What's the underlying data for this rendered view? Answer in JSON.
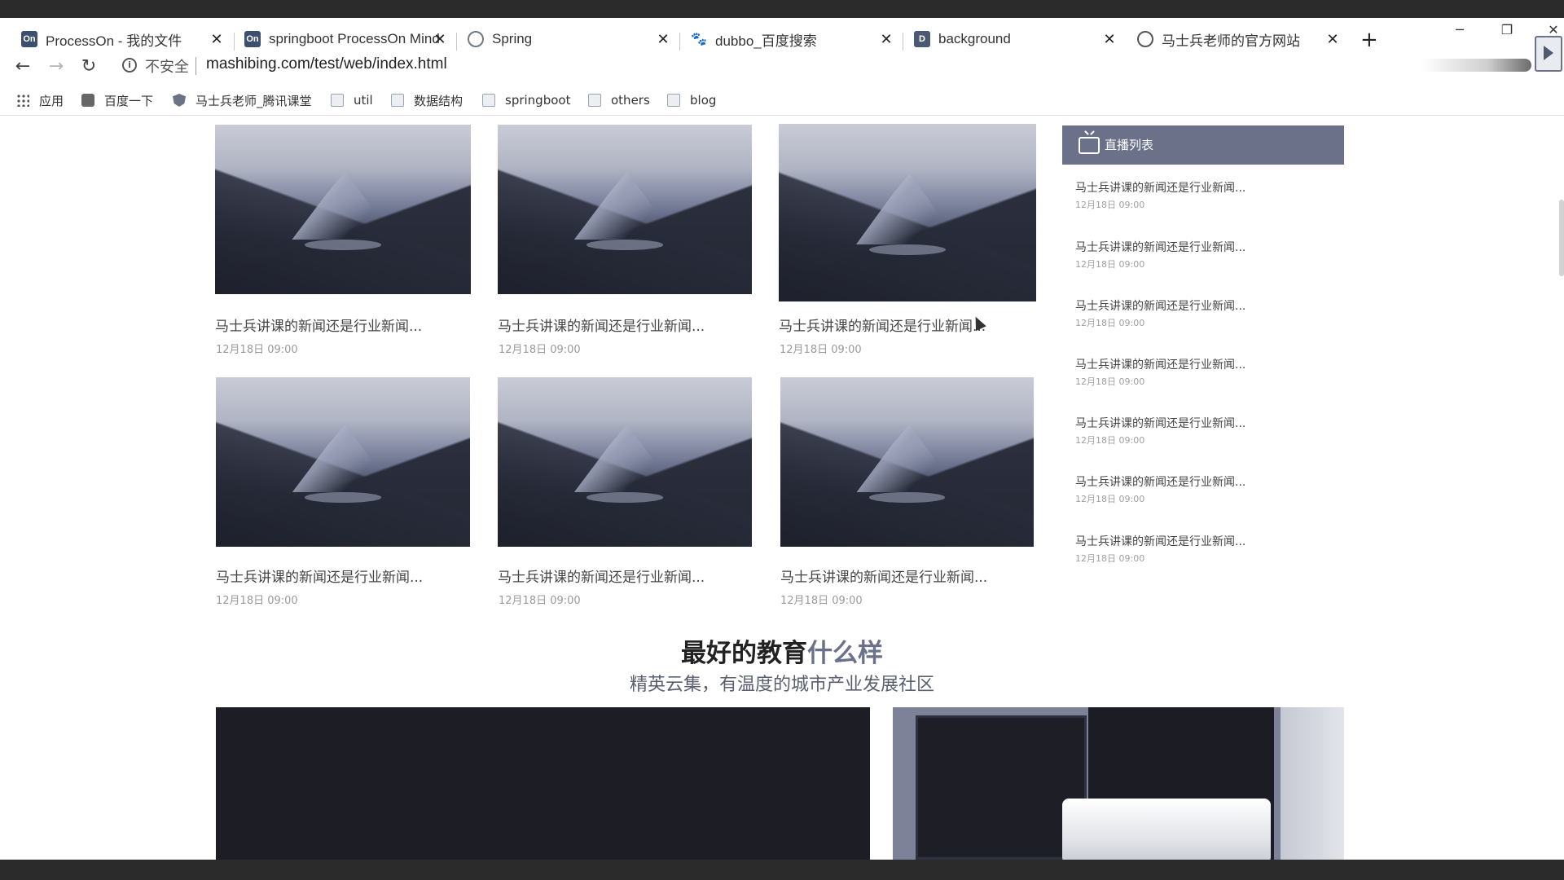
{
  "browser": {
    "tabs": [
      {
        "title": "ProcessOn - 我的文件",
        "favicon": "processon-icon"
      },
      {
        "title": "springboot ProcessOn Mind",
        "favicon": "processon-icon"
      },
      {
        "title": "Spring",
        "favicon": "spring-icon"
      },
      {
        "title": "dubbo_百度搜索",
        "favicon": "baidu-paw-icon"
      },
      {
        "title": "background",
        "favicon": "document-icon"
      },
      {
        "title": "马士兵老师的官方网站",
        "favicon": "globe-icon"
      }
    ],
    "new_tab": "+",
    "controls": {
      "minimize": "─",
      "restore": "❐",
      "close": "✕"
    },
    "address": {
      "security_label": "不安全",
      "url": "mashibing.com/test/web/index.html"
    },
    "bookmarks": [
      {
        "label": "应用",
        "icon": "apps-grid-icon"
      },
      {
        "label": "百度一下",
        "icon": "baidu-paw-icon"
      },
      {
        "label": "马士兵老师_腾讯课堂",
        "icon": "shield-icon"
      },
      {
        "label": "util",
        "icon": "folder-icon"
      },
      {
        "label": "数据结构",
        "icon": "folder-icon"
      },
      {
        "label": "springboot",
        "icon": "folder-icon"
      },
      {
        "label": "others",
        "icon": "folder-icon"
      },
      {
        "label": "blog",
        "icon": "folder-icon"
      }
    ]
  },
  "news": [
    {
      "title": "马士兵讲课的新闻还是行业新闻...",
      "date": "12月18日 09:00"
    },
    {
      "title": "马士兵讲课的新闻还是行业新闻...",
      "date": "12月18日 09:00"
    },
    {
      "title": "马士兵讲课的新闻还是行业新闻...",
      "date": "12月18日 09:00"
    },
    {
      "title": "马士兵讲课的新闻还是行业新闻...",
      "date": "12月18日 09:00"
    },
    {
      "title": "马士兵讲课的新闻还是行业新闻...",
      "date": "12月18日 09:00"
    },
    {
      "title": "马士兵讲课的新闻还是行业新闻...",
      "date": "12月18日 09:00"
    }
  ],
  "live": {
    "title": "直播列表",
    "items": [
      {
        "title": "马士兵讲课的新闻还是行业新闻...",
        "date": "12月18日 09:00"
      },
      {
        "title": "马士兵讲课的新闻还是行业新闻...",
        "date": "12月18日 09:00"
      },
      {
        "title": "马士兵讲课的新闻还是行业新闻...",
        "date": "12月18日 09:00"
      },
      {
        "title": "马士兵讲课的新闻还是行业新闻...",
        "date": "12月18日 09:00"
      },
      {
        "title": "马士兵讲课的新闻还是行业新闻...",
        "date": "12月18日 09:00"
      },
      {
        "title": "马士兵讲课的新闻还是行业新闻...",
        "date": "12月18日 09:00"
      },
      {
        "title": "马士兵讲课的新闻还是行业新闻...",
        "date": "12月18日 09:00"
      }
    ]
  },
  "section": {
    "title_dark": "最好的教育",
    "title_accent": "什么样",
    "subtitle": "精英云集，有温度的城市产业发展社区"
  },
  "colors": {
    "accent": "#6a7188",
    "dark_panel": "#1c1d25"
  }
}
